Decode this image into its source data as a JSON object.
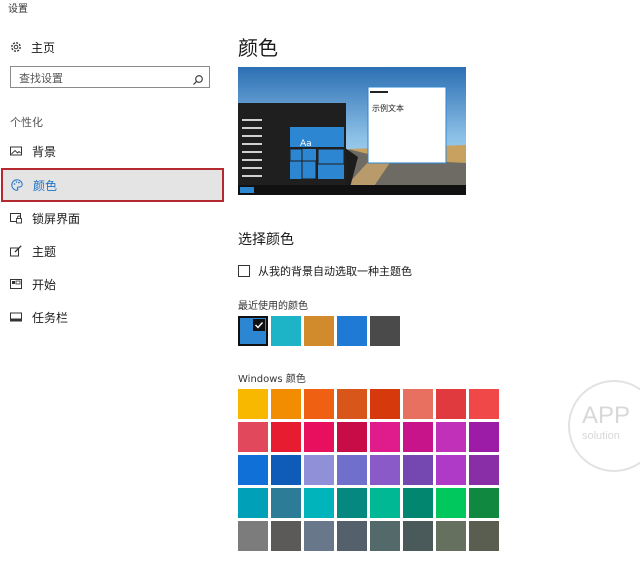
{
  "window": {
    "title": "设置"
  },
  "sidebar": {
    "home_label": "主页",
    "search_placeholder": "查找设置",
    "group_label": "个性化",
    "items": [
      {
        "label": "背景",
        "icon": "image-icon"
      },
      {
        "label": "颜色",
        "icon": "palette-icon",
        "selected": true
      },
      {
        "label": "锁屏界面",
        "icon": "lock-screen-icon"
      },
      {
        "label": "主题",
        "icon": "brush-icon"
      },
      {
        "label": "开始",
        "icon": "start-icon"
      },
      {
        "label": "任务栏",
        "icon": "taskbar-icon"
      }
    ]
  },
  "main": {
    "title": "颜色",
    "preview": {
      "tile_label": "Aa",
      "sample_text": "示例文本"
    },
    "section_title": "选择颜色",
    "auto_pick_label": "从我的背景自动选取一种主题色",
    "auto_pick_checked": false,
    "recent_label": "最近使用的颜色",
    "recent_colors": [
      "#2d86d1",
      "#1cb4c6",
      "#d18a2c",
      "#1f7ad6",
      "#4a4a4a"
    ],
    "recent_selected_index": 0,
    "windows_label": "Windows 颜色",
    "windows_colors": [
      "#f8b800",
      "#f28c00",
      "#f06012",
      "#d8561a",
      "#d63a0c",
      "#e87060",
      "#e03a3e",
      "#f04848",
      "#e2485c",
      "#e81c30",
      "#e8105e",
      "#c80c48",
      "#e01c8c",
      "#c8148a",
      "#c030b8",
      "#9c1ca8",
      "#1070d8",
      "#0e5cb8",
      "#9090d8",
      "#7070cc",
      "#8a5ac8",
      "#7448b0",
      "#b03ac8",
      "#8a2ea8",
      "#00a0b8",
      "#2c7c98",
      "#00b4bc",
      "#048880",
      "#00b894",
      "#038670",
      "#00c85c",
      "#108840",
      "#7c7c7c",
      "#5c5a58",
      "#68788a",
      "#54606c",
      "#546a6a",
      "#4a5a5a",
      "#66705e",
      "#5a5e50"
    ]
  },
  "watermark": {
    "line1": "APP",
    "line2": "solution"
  }
}
